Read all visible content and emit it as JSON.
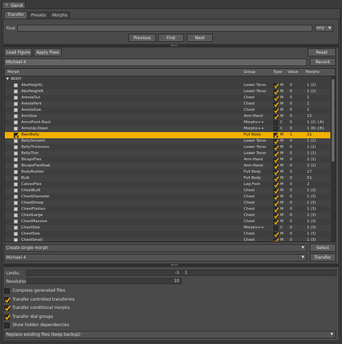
{
  "window": {
    "title": "GenX",
    "title_icon": "close-x-icon"
  },
  "tabs": [
    {
      "label": "Transfer",
      "active": true
    },
    {
      "label": "Presets"
    },
    {
      "label": "Morphs"
    }
  ],
  "find": {
    "label": "Find:",
    "value": "",
    "scope": "any"
  },
  "nav": {
    "previous": "Previous",
    "first": "First",
    "next": "Next"
  },
  "toolbar": {
    "load_figure": "Load Figure",
    "apply_pose": "Apply Pose",
    "reset": "Reset"
  },
  "figure": {
    "selected": "Michael 4",
    "recent_label": "Recent"
  },
  "table": {
    "headers": [
      "Morph",
      "Group",
      "Type",
      "Value",
      "Morphs"
    ],
    "group_label": "BODY",
    "rows": [
      {
        "name": "AbsHeightL",
        "group": "Lower Torso",
        "type": "M",
        "value": "0",
        "morphs": "1 (2)",
        "checked": false,
        "type_checked": true
      },
      {
        "name": "AbsHeightR",
        "group": "Lower Torso",
        "type": "M",
        "value": "0",
        "morphs": "1 (2)",
        "checked": false,
        "type_checked": true
      },
      {
        "name": "AreolaOut",
        "group": "Chest",
        "type": "M",
        "value": "0",
        "morphs": "1",
        "checked": false,
        "type_checked": true
      },
      {
        "name": "AreolaPerk",
        "group": "Chest",
        "type": "M",
        "value": "0",
        "morphs": "1",
        "checked": false,
        "type_checked": true
      },
      {
        "name": "AreolaSize",
        "group": "Chest",
        "type": "M",
        "value": "0",
        "morphs": "1",
        "checked": false,
        "type_checked": true
      },
      {
        "name": "ArmSize",
        "group": "Arm-Hand",
        "type": "M",
        "value": "0",
        "morphs": "12",
        "checked": false,
        "type_checked": true
      },
      {
        "name": "ArmsFront-Back",
        "group": "Morphs++",
        "type": "C",
        "value": "0",
        "morphs": "1 (2) {4}",
        "checked": false,
        "type_checked": false
      },
      {
        "name": "ArmsUp-Down",
        "group": "Morphs++",
        "type": "C",
        "value": "0",
        "morphs": "1 (6) {8}",
        "checked": false,
        "type_checked": false
      },
      {
        "name": "BeerBelly",
        "group": "Full Body",
        "type": "M",
        "value": "1",
        "morphs": "21",
        "checked": true,
        "type_checked": true,
        "selected": true
      },
      {
        "name": "BellySmooth",
        "group": "Lower Torso",
        "type": "M",
        "value": "0",
        "morphs": "1 (2)",
        "checked": false,
        "type_checked": true
      },
      {
        "name": "BellyThickness",
        "group": "Lower Torso",
        "type": "M",
        "value": "0",
        "morphs": "1 (2)",
        "checked": false,
        "type_checked": true
      },
      {
        "name": "BellyThin",
        "group": "Lower Torso",
        "type": "M",
        "value": "0",
        "morphs": "1 (1)",
        "checked": false,
        "type_checked": true
      },
      {
        "name": "BicepsFlex",
        "group": "Arm-Hand",
        "type": "M",
        "value": "0",
        "morphs": "2 (2)",
        "checked": false,
        "type_checked": true
      },
      {
        "name": "BicepsFlexPeak",
        "group": "Arm-Hand",
        "type": "M",
        "value": "0",
        "morphs": "2 (2)",
        "checked": false,
        "type_checked": true
      },
      {
        "name": "BodyBuilder",
        "group": "Full Body",
        "type": "M",
        "value": "0",
        "morphs": "17",
        "checked": false,
        "type_checked": true
      },
      {
        "name": "Bulk",
        "group": "Full Body",
        "type": "M",
        "value": "0",
        "morphs": "51",
        "checked": false,
        "type_checked": true
      },
      {
        "name": "CalvesFlex",
        "group": "Leg-Foot",
        "type": "M",
        "value": "0",
        "morphs": "2",
        "checked": false,
        "type_checked": true
      },
      {
        "name": "ChestBuilt",
        "group": "Chest",
        "type": "M",
        "value": "0",
        "morphs": "1 (3)",
        "checked": false,
        "type_checked": true
      },
      {
        "name": "ChestDiameter",
        "group": "Chest",
        "type": "M",
        "value": "0",
        "morphs": "1 (3)",
        "checked": false,
        "type_checked": true
      },
      {
        "name": "ChestDroop",
        "group": "Chest",
        "type": "M",
        "value": "0",
        "morphs": "1 (3)",
        "checked": false,
        "type_checked": true
      },
      {
        "name": "ChestFlatten",
        "group": "Chest",
        "type": "M",
        "value": "0",
        "morphs": "1 (3)",
        "checked": false,
        "type_checked": true
      },
      {
        "name": "ChestLarge",
        "group": "Chest",
        "type": "M",
        "value": "0",
        "morphs": "1 (3)",
        "checked": false,
        "type_checked": true
      },
      {
        "name": "ChestMassive",
        "group": "Chest",
        "type": "M",
        "value": "0",
        "morphs": "1 (3)",
        "checked": false,
        "type_checked": true
      },
      {
        "name": "ChestSize",
        "group": "Morphs++",
        "type": "C",
        "value": "0",
        "morphs": "1 (3)",
        "checked": false,
        "type_checked": false
      },
      {
        "name": "ChestSize",
        "group": "Chest",
        "type": "M",
        "value": "0",
        "morphs": "1 (3)",
        "checked": false,
        "type_checked": true
      },
      {
        "name": "ChestSmall",
        "group": "Chest",
        "type": "M",
        "value": "0",
        "morphs": "1 (3)",
        "checked": false,
        "type_checked": true
      }
    ]
  },
  "create": {
    "mode": "Create single morph",
    "select_label": "Select"
  },
  "target": {
    "figure": "Michael 4",
    "transfer_label": "Transfer"
  },
  "limits": {
    "label": "Limits:",
    "min": "-1",
    "max": "1"
  },
  "resolution": {
    "label": "Resolution:",
    "value": "10"
  },
  "options": [
    {
      "label": "Compress generated files",
      "checked": false
    },
    {
      "label": "Transfer controlled transforms",
      "checked": true
    },
    {
      "label": "Transfer conditional morphs",
      "checked": true
    },
    {
      "label": "Transfer dial groups",
      "checked": true
    },
    {
      "label": "Show hidden dependencies",
      "checked": false
    }
  ],
  "replace": {
    "mode": "Replace existing files (keep backup)"
  },
  "colors": {
    "accent": "#f2b100",
    "background": "#3a3a3a",
    "panel": "#474747",
    "row_alt": "#434343"
  }
}
